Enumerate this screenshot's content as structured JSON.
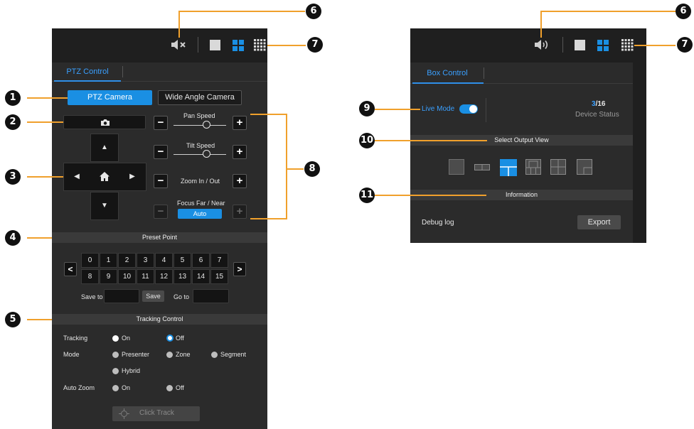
{
  "left_panel": {
    "tab_label": "PTZ Control",
    "camera_tabs": {
      "active": "PTZ Camera",
      "inactive": "Wide Angle Camera"
    },
    "speed_controls": {
      "pan_label": "Pan Speed",
      "tilt_label": "Tilt Speed",
      "zoom_label": "Zoom In / Out",
      "focus_label": "Focus Far / Near",
      "focus_auto": "Auto",
      "minus": "−",
      "plus": "+"
    },
    "preset": {
      "title": "Preset Point",
      "row1": [
        "0",
        "1",
        "2",
        "3",
        "4",
        "5",
        "6",
        "7"
      ],
      "row2": [
        "8",
        "9",
        "10",
        "11",
        "12",
        "13",
        "14",
        "15"
      ],
      "save_to_label": "Save to",
      "save_button": "Save",
      "go_to_label": "Go to",
      "prev": "<",
      "next": ">"
    },
    "tracking": {
      "title": "Tracking Control",
      "tracking_label": "Tracking",
      "on": "On",
      "off": "Off",
      "mode_label": "Mode",
      "presenter": "Presenter",
      "zone": "Zone",
      "segment": "Segment",
      "hybrid": "Hybrid",
      "auto_zoom_label": "Auto Zoom",
      "click_track": "Click Track"
    }
  },
  "right_panel": {
    "tab_label": "Box Control",
    "live_mode_label": "Live Mode",
    "device_count_current": "3",
    "device_count_total": "/16",
    "device_status_label": "Device Status",
    "select_output_title": "Select Output View",
    "information_title": "Information",
    "debug_log_label": "Debug log",
    "export_button": "Export"
  },
  "callouts": [
    "1",
    "2",
    "3",
    "4",
    "5",
    "6",
    "7",
    "8",
    "9",
    "10",
    "11",
    "6",
    "7"
  ],
  "colors": {
    "accent": "#1a8fe3",
    "callout_line": "#f0a02c",
    "panel_bg": "#2b2b2b"
  }
}
